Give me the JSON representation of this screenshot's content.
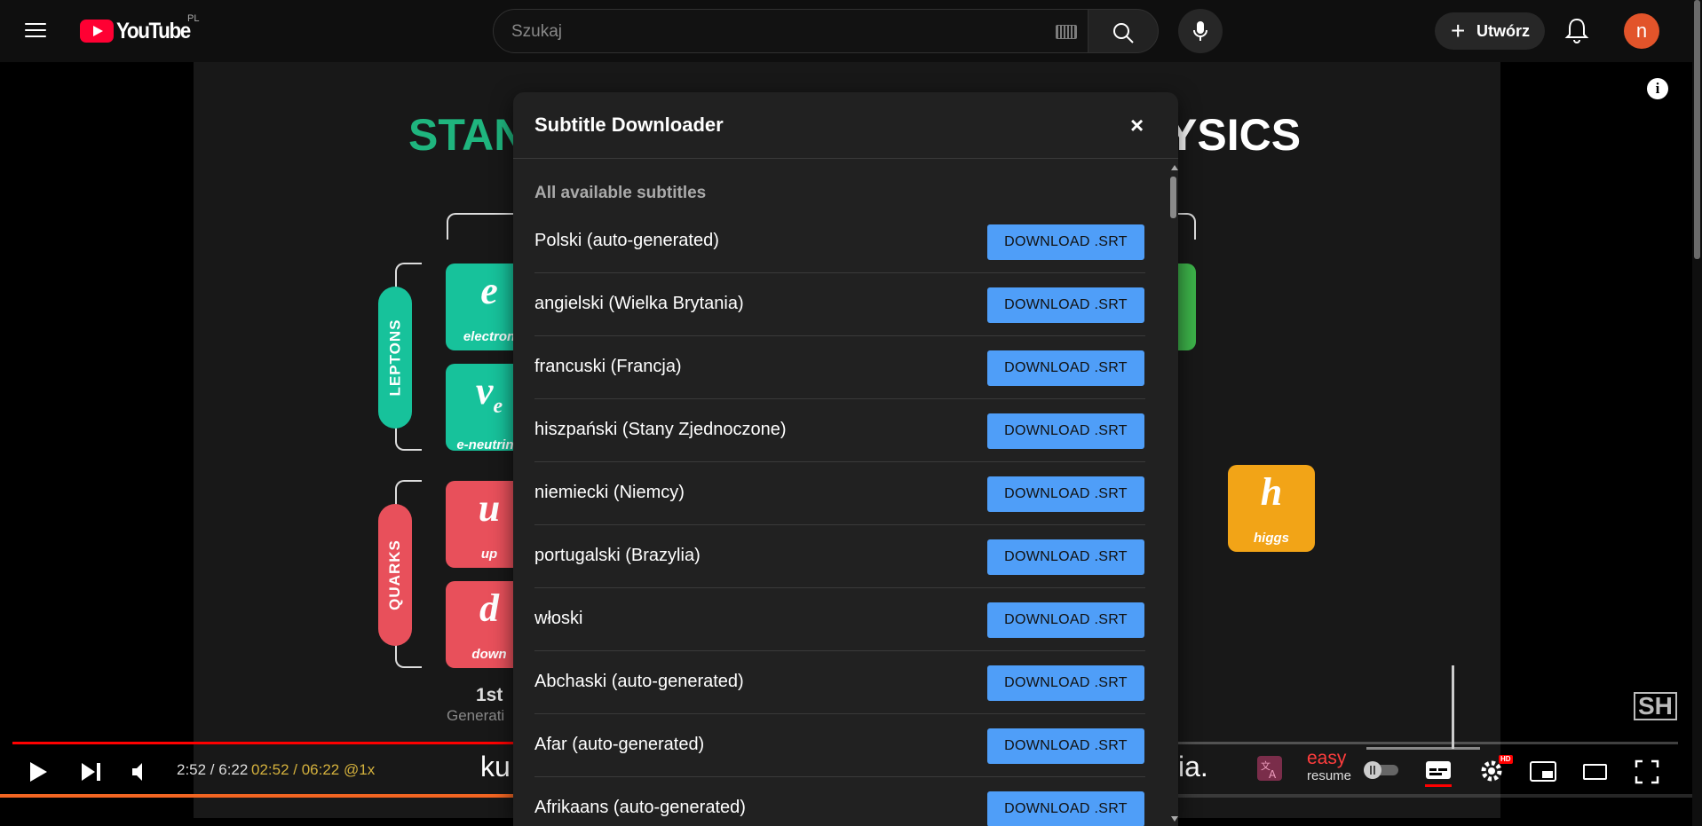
{
  "header": {
    "logo_text": "YouTube",
    "region": "PL",
    "search_placeholder": "Szukaj",
    "create_label": "Utwórz",
    "avatar_initial": "n"
  },
  "video": {
    "title_left": "STAN",
    "title_right": "YSICS",
    "groups": {
      "leptons": "LEPTONS",
      "quarks": "QUARKS"
    },
    "tiles": [
      {
        "symbol": "e",
        "name": "electron",
        "color": "#17c29b"
      },
      {
        "symbol": "ν",
        "name": "e-neutrino",
        "color": "#17c29b"
      },
      {
        "symbol": "u",
        "name": "up",
        "color": "#e8505b"
      },
      {
        "symbol": "d",
        "name": "down",
        "color": "#e8505b"
      },
      {
        "symbol": "h",
        "name": "higgs",
        "color": "#f2a417"
      }
    ],
    "neutrino_subscript": "e",
    "generation_number": "1st",
    "generation_label": "Generati",
    "watermark": "SH"
  },
  "player": {
    "time_current": "2:52 / 6:22",
    "time_extension": "02:52 / 06:22 @1x",
    "progress_fraction": 0.452,
    "caption_left": "ku",
    "caption_right": "ia.",
    "easy_label": "easy",
    "resume_label": "resume",
    "hd_label": "HD"
  },
  "modal": {
    "title": "Subtitle Downloader",
    "close_label": "×",
    "section_heading": "All available subtitles",
    "download_label": "DOWNLOAD .SRT",
    "subtitles": [
      "Polski (auto-generated)",
      "angielski (Wielka Brytania)",
      "francuski (Francja)",
      "hiszpański (Stany Zjednoczone)",
      "niemiecki (Niemcy)",
      "portugalski (Brazylia)",
      "włoski",
      "Abchaski (auto-generated)",
      "Afar (auto-generated)",
      "Afrikaans (auto-generated)"
    ]
  }
}
